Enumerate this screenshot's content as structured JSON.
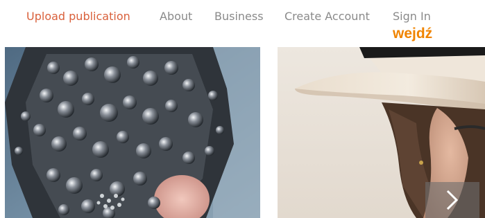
{
  "nav": {
    "upload": "Upload publication",
    "about": "About",
    "business": "Business",
    "create_account": "Create Account",
    "sign_in": "Sign In",
    "overlay_text": "wejdź"
  },
  "gallery": {
    "left_image": "jeweled-headpiece-photo",
    "right_image": "woman-in-white-hat-photo",
    "next_icon": "chevron-right-icon"
  },
  "colors": {
    "accent": "#d9603b",
    "overlay": "#f08400",
    "nav_text": "#8a8a8a"
  }
}
